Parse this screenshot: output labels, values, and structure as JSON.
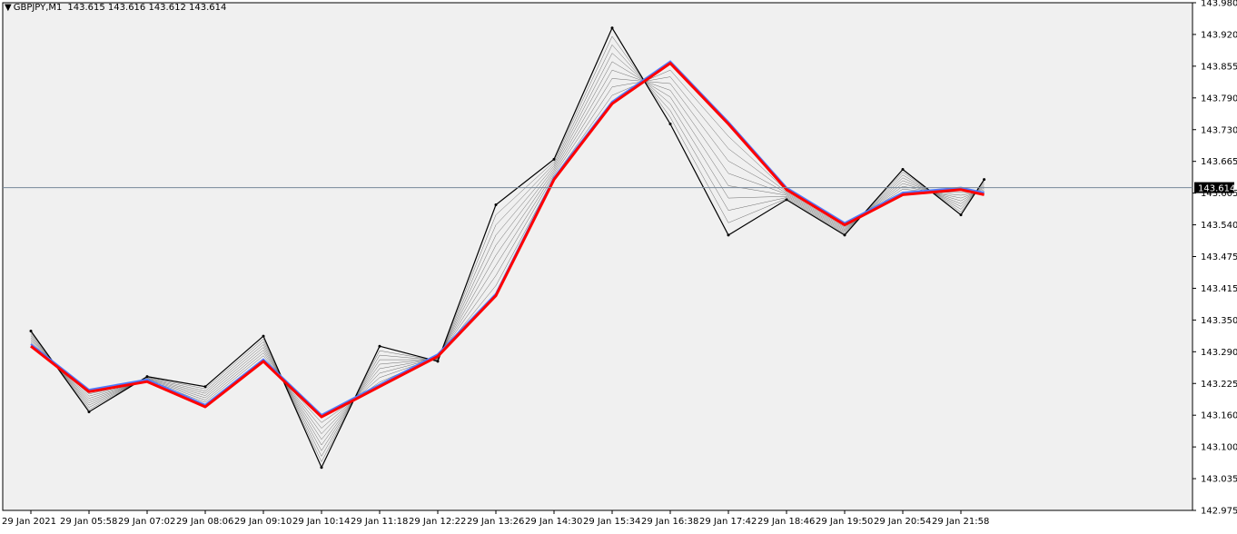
{
  "header": {
    "symbol": "GBPJPY,M1",
    "quotes": "143.615 143.616 143.612 143.614",
    "menu_icon": "triangle-down-icon"
  },
  "colors": {
    "background": "#f0f0f0",
    "price": "#000000",
    "ema_main": "#ff0000",
    "ema_blue": "#4f7bff",
    "ema_fan": "#000000",
    "bid_line": "#778899"
  },
  "chart_data": {
    "type": "line",
    "title": "GBPJPY,M1",
    "current_price": 143.614,
    "current_price_label": "143.614",
    "ylim": [
      142.975,
      143.98
    ],
    "y_ticks": [
      "143.980",
      "143.920",
      "143.855",
      "143.790",
      "143.730",
      "143.665",
      "143.605",
      "143.540",
      "143.475",
      "143.415",
      "143.350",
      "143.290",
      "143.225",
      "143.160",
      "143.100",
      "143.035",
      "142.975"
    ],
    "x_ticks": [
      "29 Jan 2021",
      "29 Jan 05:58",
      "29 Jan 07:02",
      "29 Jan 08:06",
      "29 Jan 09:10",
      "29 Jan 10:14",
      "29 Jan 11:18",
      "29 Jan 12:22",
      "29 Jan 13:26",
      "29 Jan 14:30",
      "29 Jan 15:34",
      "29 Jan 16:38",
      "29 Jan 17:42",
      "29 Jan 18:46",
      "29 Jan 19:50",
      "29 Jan 20:54",
      "29 Jan 21:58"
    ],
    "x_index": [
      0,
      1,
      2,
      3,
      4,
      5,
      6,
      7,
      8,
      9,
      10,
      11,
      12,
      13,
      14,
      15,
      16,
      16.4
    ],
    "series": [
      {
        "name": "price",
        "values": [
          143.33,
          143.17,
          143.24,
          143.22,
          143.32,
          143.06,
          143.3,
          143.27,
          143.58,
          143.67,
          143.93,
          143.74,
          143.52,
          143.59,
          143.52,
          143.65,
          143.56,
          143.63
        ]
      },
      {
        "name": "ema",
        "values": [
          143.3,
          143.21,
          143.23,
          143.18,
          143.27,
          143.16,
          143.22,
          143.28,
          143.4,
          143.63,
          143.78,
          143.86,
          143.74,
          143.61,
          143.54,
          143.6,
          143.61,
          143.6
        ]
      }
    ],
    "grid": false
  }
}
